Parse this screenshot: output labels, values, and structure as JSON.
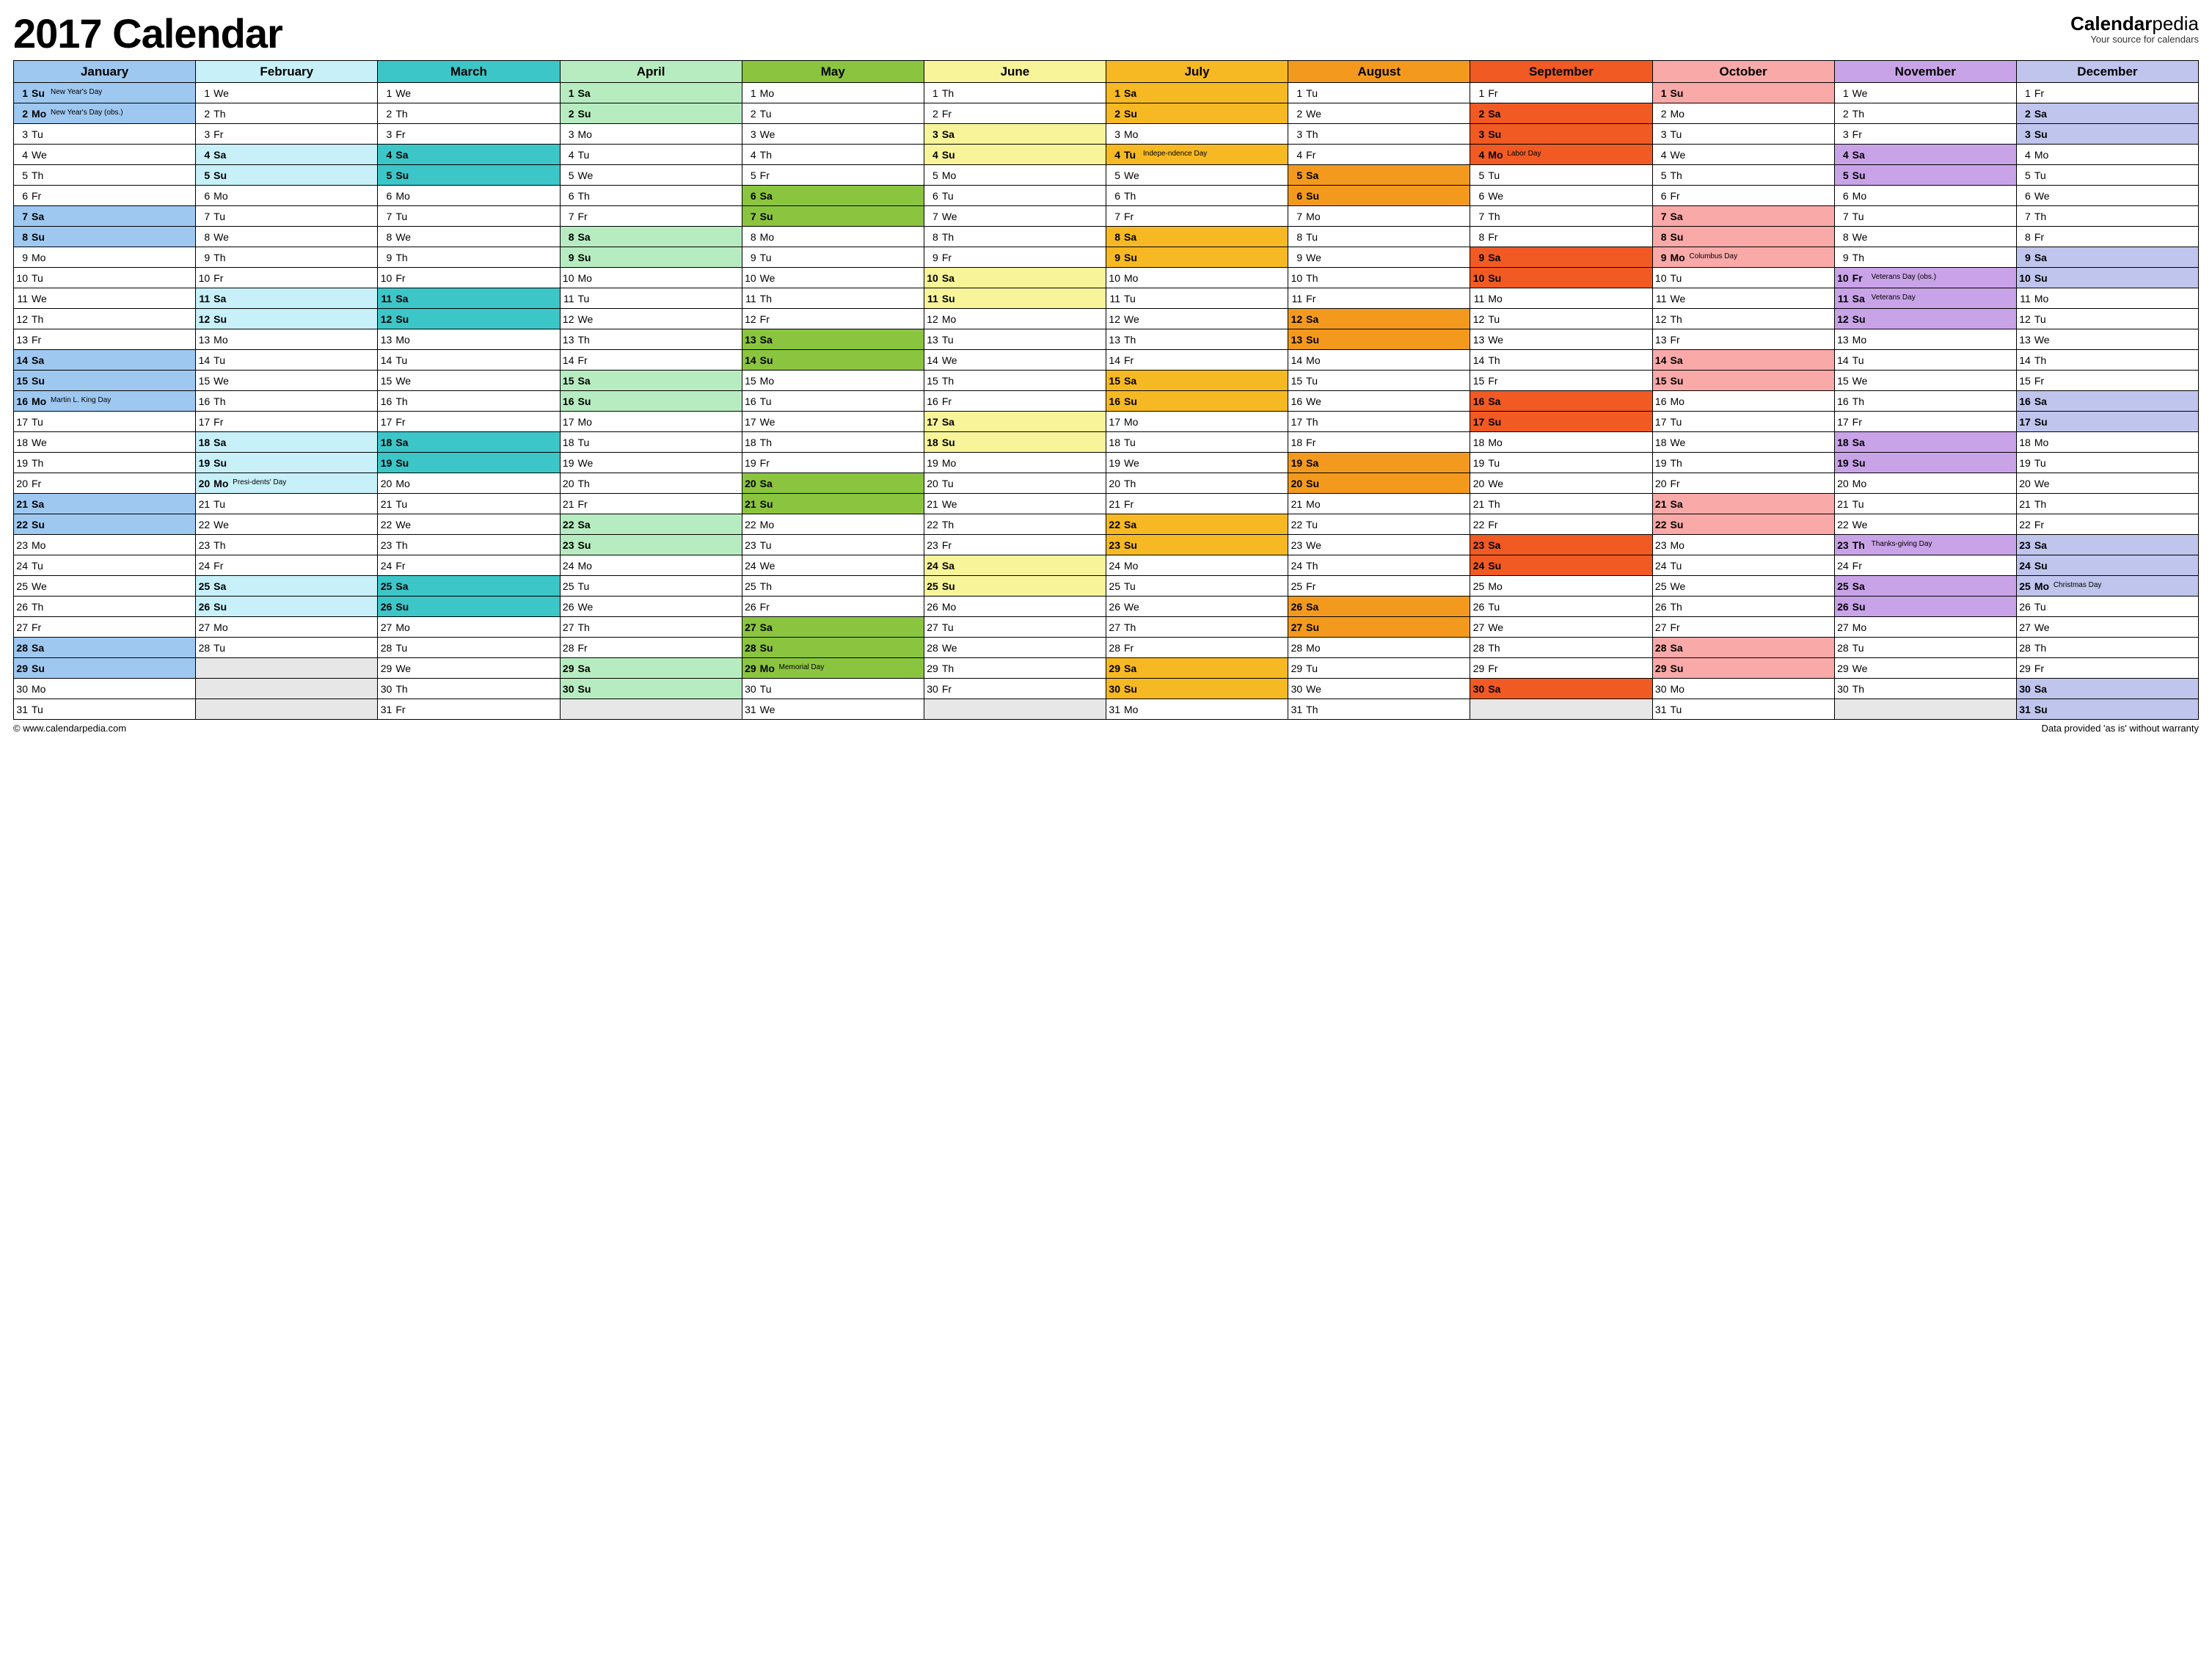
{
  "title": "2017 Calendar",
  "brand": {
    "main_bold": "Calendar",
    "main_rest": "pedia",
    "sub": "Your source for calendars"
  },
  "footer_left": "© www.calendarpedia.com",
  "footer_right": "Data provided 'as is' without warranty",
  "dow": [
    "Su",
    "Mo",
    "Tu",
    "We",
    "Th",
    "Fr",
    "Sa"
  ],
  "months": [
    {
      "name": "January",
      "first_dow": 0,
      "ndays": 31,
      "colors": {
        "head": "#9fc8f0",
        "weekend": "#9fc8f0",
        "holiday": "#9fc8f0"
      }
    },
    {
      "name": "February",
      "first_dow": 3,
      "ndays": 28,
      "colors": {
        "head": "#c7f0f8",
        "weekend": "#c7f0f8",
        "holiday": "#c7f0f8"
      }
    },
    {
      "name": "March",
      "first_dow": 3,
      "ndays": 31,
      "colors": {
        "head": "#3cc6c8",
        "weekend": "#3cc6c8",
        "holiday": "#3cc6c8"
      }
    },
    {
      "name": "April",
      "first_dow": 6,
      "ndays": 30,
      "colors": {
        "head": "#b7ecc1",
        "weekend": "#b7ecc1",
        "holiday": "#b7ecc1"
      }
    },
    {
      "name": "May",
      "first_dow": 1,
      "ndays": 31,
      "colors": {
        "head": "#8bc53f",
        "weekend": "#8bc53f",
        "holiday": "#8bc53f"
      }
    },
    {
      "name": "June",
      "first_dow": 4,
      "ndays": 30,
      "colors": {
        "head": "#f8f49a",
        "weekend": "#f8f49a",
        "holiday": "#f8f49a"
      }
    },
    {
      "name": "July",
      "first_dow": 6,
      "ndays": 31,
      "colors": {
        "head": "#f6b923",
        "weekend": "#f6b923",
        "holiday": "#f6b923"
      }
    },
    {
      "name": "August",
      "first_dow": 2,
      "ndays": 31,
      "colors": {
        "head": "#f39a1e",
        "weekend": "#f39a1e",
        "holiday": "#f39a1e"
      }
    },
    {
      "name": "September",
      "first_dow": 5,
      "ndays": 30,
      "colors": {
        "head": "#f15a22",
        "weekend": "#f15a22",
        "holiday": "#f15a22"
      }
    },
    {
      "name": "October",
      "first_dow": 0,
      "ndays": 31,
      "colors": {
        "head": "#f8a9a8",
        "weekend": "#f8a9a8",
        "holiday": "#f8a9a8"
      }
    },
    {
      "name": "November",
      "first_dow": 3,
      "ndays": 30,
      "colors": {
        "head": "#c9a3e8",
        "weekend": "#c9a3e8",
        "holiday": "#c9a3e8"
      }
    },
    {
      "name": "December",
      "first_dow": 5,
      "ndays": 31,
      "colors": {
        "head": "#bfc5ec",
        "weekend": "#bfc5ec",
        "holiday": "#bfc5ec"
      }
    }
  ],
  "holidays": {
    "0": {
      "1": "New Year's Day",
      "2": "New Year's Day (obs.)",
      "16": "Martin L. King Day"
    },
    "1": {
      "20": "Presi-dents' Day"
    },
    "4": {
      "29": "Memorial Day"
    },
    "6": {
      "4": "Indepe-ndence Day"
    },
    "8": {
      "4": "Labor Day"
    },
    "9": {
      "9": "Columbus Day"
    },
    "10": {
      "10": "Veterans Day (obs.)",
      "11": "Veterans Day",
      "23": "Thanks-giving Day"
    },
    "11": {
      "25": "Christmas Day"
    }
  }
}
